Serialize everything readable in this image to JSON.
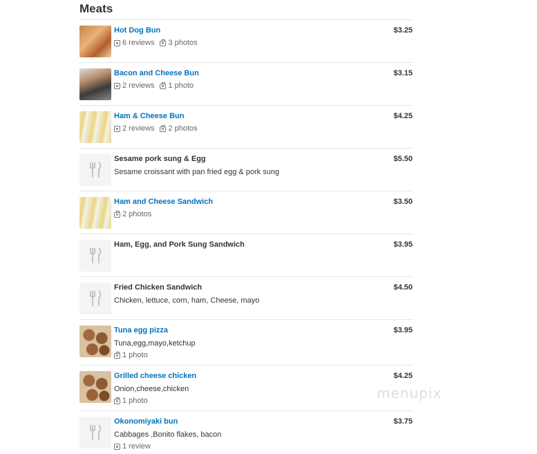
{
  "section": {
    "title": "Meats"
  },
  "watermark": "menupix",
  "items": [
    {
      "name": "Hot Dog Bun",
      "price": "$3.25",
      "description": "",
      "reviews": "6 reviews",
      "photos": "3 photos",
      "image": "hot-dog-bun-photo"
    },
    {
      "name": "Bacon and Cheese Bun",
      "price": "$3.15",
      "description": "",
      "reviews": "2 reviews",
      "photos": "1 photo",
      "image": "bacon-cheese-bun-photo"
    },
    {
      "name": "Ham & Cheese Bun",
      "price": "$4.25",
      "description": "",
      "reviews": "2 reviews",
      "photos": "2 photos",
      "image": "ham-cheese-bun-photo"
    },
    {
      "name": "Sesame pork sung & Egg",
      "price": "$5.50",
      "description": "Sesame croissant with pan fried egg & pork sung",
      "reviews": "",
      "photos": "",
      "image": "utensils-placeholder"
    },
    {
      "name": "Ham and Cheese Sandwich",
      "price": "$3.50",
      "description": "",
      "reviews": "",
      "photos": "2 photos",
      "image": "ham-cheese-sandwich-photo"
    },
    {
      "name": "Ham, Egg, and Pork Sung Sandwich",
      "price": "$3.95",
      "description": "",
      "reviews": "",
      "photos": "",
      "image": "utensils-placeholder"
    },
    {
      "name": "Fried Chicken Sandwich",
      "price": "$4.50",
      "description": "Chicken, lettuce, corn, ham, Cheese, mayo",
      "reviews": "",
      "photos": "",
      "image": "utensils-placeholder"
    },
    {
      "name": "Tuna egg pizza",
      "price": "$3.95",
      "description": "Tuna,egg,mayo,ketchup",
      "reviews": "",
      "photos": "1 photo",
      "image": "tuna-egg-pizza-photo"
    },
    {
      "name": "Grilled cheese chicken",
      "price": "$4.25",
      "description": "Onion,cheese,chicken",
      "reviews": "",
      "photos": "1 photo",
      "image": "grilled-cheese-chicken-photo"
    },
    {
      "name": "Okonomiyaki bun",
      "price": "$3.75",
      "description": "Cabbages ,Bonito flakes, bacon",
      "reviews": "1 review",
      "photos": "",
      "image": "utensils-placeholder"
    }
  ],
  "colors": {
    "link": "#0073bb",
    "text": "#333333",
    "muted": "#666666",
    "divider": "#e6e6e6"
  }
}
